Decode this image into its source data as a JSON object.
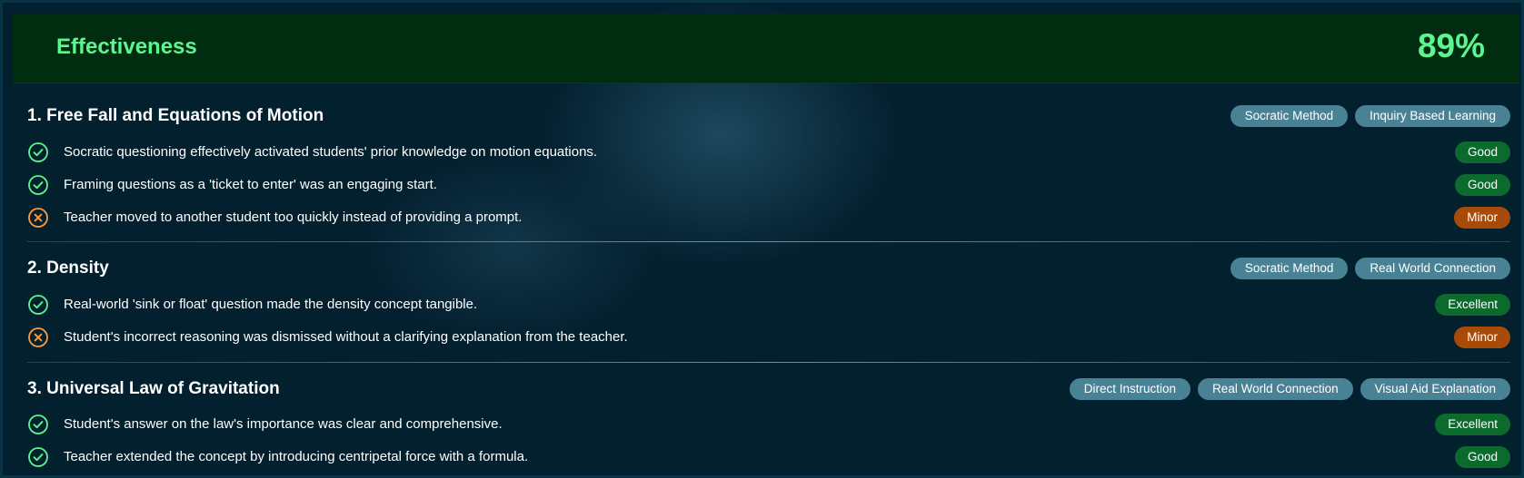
{
  "header": {
    "title": "Effectiveness",
    "score": "89%"
  },
  "colors": {
    "good_icon": "#5df58f",
    "minor_icon": "#ff9a3c",
    "good_badge": "#0b6a2c",
    "minor_badge": "#a84b08",
    "tag": "#4a8295"
  },
  "sections": [
    {
      "title": "1. Free Fall and Equations of Motion",
      "tags": [
        "Socratic Method",
        "Inquiry Based Learning"
      ],
      "items": [
        {
          "icon": "check-circle-icon",
          "text": "Socratic questioning effectively activated students' prior knowledge on motion equations.",
          "rating": "Good"
        },
        {
          "icon": "check-circle-icon",
          "text": "Framing questions as a 'ticket to enter' was an engaging start.",
          "rating": "Good"
        },
        {
          "icon": "x-circle-icon",
          "text": "Teacher moved to another student too quickly instead of providing a prompt.",
          "rating": "Minor"
        }
      ]
    },
    {
      "title": "2. Density",
      "tags": [
        "Socratic Method",
        "Real World Connection"
      ],
      "items": [
        {
          "icon": "check-circle-icon",
          "text": "Real-world 'sink or float' question made the density concept tangible.",
          "rating": "Excellent"
        },
        {
          "icon": "x-circle-icon",
          "text": "Student's incorrect reasoning was dismissed without a clarifying explanation from the teacher.",
          "rating": "Minor"
        }
      ]
    },
    {
      "title": "3. Universal Law of Gravitation",
      "tags": [
        "Direct Instruction",
        "Real World Connection",
        "Visual Aid Explanation"
      ],
      "items": [
        {
          "icon": "check-circle-icon",
          "text": "Student's answer on the law's importance was clear and comprehensive.",
          "rating": "Excellent"
        },
        {
          "icon": "check-circle-icon",
          "text": "Teacher extended the concept by introducing centripetal force with a formula.",
          "rating": "Good"
        }
      ]
    }
  ]
}
